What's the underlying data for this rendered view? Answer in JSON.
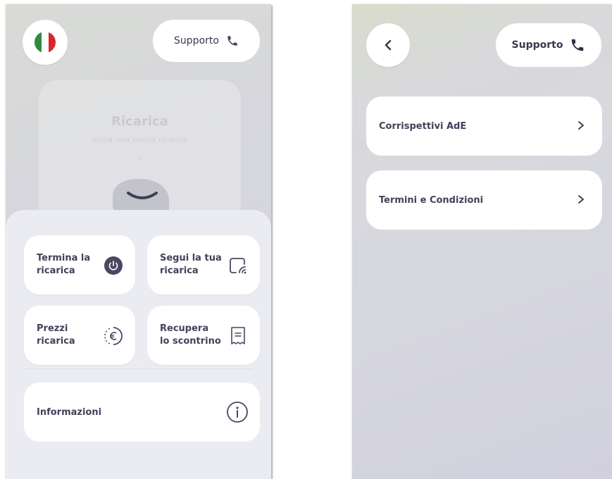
{
  "left_screen": {
    "support_label": "Supporto",
    "background_card": {
      "title": "Ricarica",
      "subtitle": "Inizia una nuova ricarica"
    },
    "actions": [
      {
        "label_line1": "Termina la",
        "label_line2": "ricarica",
        "icon": "power-icon"
      },
      {
        "label_line1": "Segui la tua",
        "label_line2": "ricarica",
        "icon": "live-charging-icon"
      },
      {
        "label_line1": "Prezzi",
        "label_line2": "ricarica",
        "icon": "euro-icon"
      },
      {
        "label_line1": "Recupera",
        "label_line2": "lo scontrino",
        "icon": "receipt-icon"
      }
    ],
    "info_label": "Informazioni"
  },
  "right_screen": {
    "support_label": "Supporto",
    "items": [
      {
        "label": "Corrispettivi AdE"
      },
      {
        "label": "Termini e Condizioni"
      }
    ]
  },
  "colors": {
    "accent_dark": "#4a4763",
    "flag_green": "#2e8b3d",
    "flag_red": "#d8262d"
  }
}
